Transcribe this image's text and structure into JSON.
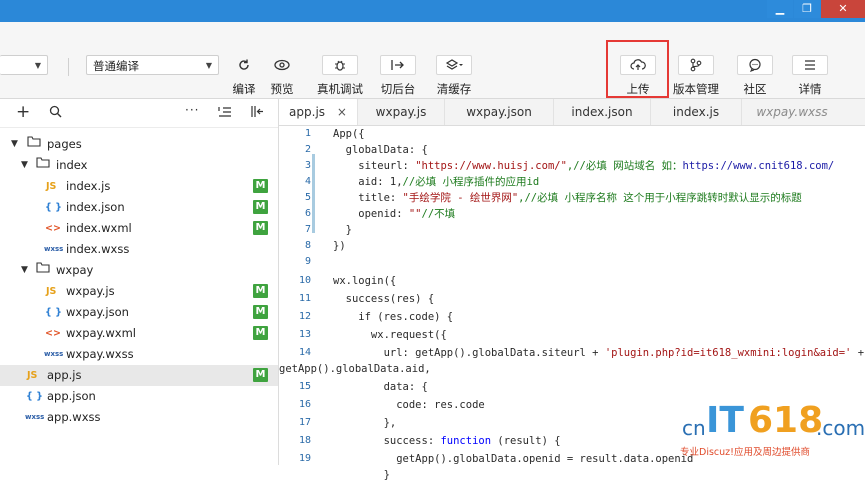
{
  "toolbar": {
    "mode_select": "普通编译",
    "buttons": {
      "compile": "编译",
      "preview": "预览",
      "remote_debug": "真机调试",
      "background": "切后台",
      "clear_cache": "清缓存",
      "upload": "上传",
      "version": "版本管理",
      "community": "社区",
      "details": "详情"
    }
  },
  "tree": {
    "pages": "pages",
    "index": "index",
    "index_js": "index.js",
    "index_json": "index.json",
    "index_wxml": "index.wxml",
    "index_wxss": "index.wxss",
    "wxpay": "wxpay",
    "wxpay_js": "wxpay.js",
    "wxpay_json": "wxpay.json",
    "wxpay_wxml": "wxpay.wxml",
    "wxpay_wxss": "wxpay.wxss",
    "app_js": "app.js",
    "app_json": "app.json",
    "app_wxss": "app.wxss",
    "modified_badge": "M",
    "icons": {
      "js": "JS",
      "json": "{ }",
      "wxml": "<>",
      "wxss": "wxss"
    }
  },
  "tabs": [
    "app.js",
    "wxpay.js",
    "wxpay.json",
    "index.json",
    "index.js",
    "wxpay.wxss"
  ],
  "tab_close": "×",
  "code": {
    "l1": "App({",
    "l2": "  globalData: {",
    "l3_key": "    siteurl: ",
    "l3_str": "\"https://www.huisj.com/\"",
    "l3_comment": ",//必填 网站域名 如：",
    "l3_link": "https://www.cnit618.com/",
    "l4_code": "    aid: 1,",
    "l4_comment": "//必填 小程序插件的应用id",
    "l5_key": "    title: ",
    "l5_str": "\"手绘学院 - 绘世界网\"",
    "l5_comment": ",//必填 小程序名称 这个用于小程序跳转时默认显示的标题",
    "l6_key": "    openid: ",
    "l6_str": "\"\"",
    "l6_comment": "//不填",
    "l7": "  }",
    "l8": "})",
    "l9": "",
    "l10": "wx.login({",
    "l11": "  success(res) {",
    "l12": "    if (res.code) {",
    "l13": "      wx.request({",
    "l14_code": "        url: getApp().globalData.siteurl + ",
    "l14_str": "'plugin.php?id=it618_wxmini:login&aid='",
    "l14_tail": " +",
    "l14_cont": "getApp().globalData.aid,",
    "l15": "        data: {",
    "l16": "          code: res.code",
    "l17": "        },",
    "l18_a": "        success: ",
    "l18_kw": "function",
    "l18_b": " (result) {",
    "l19": "          getApp().globalData.openid = result.data.openid",
    "l20": "        }"
  },
  "watermark": {
    "cn": "cn",
    "it": "IT",
    "num": "618",
    "com": ".com",
    "tagline": "专业Discuz!应用及周边提供商"
  },
  "colors": {
    "accent_blue": "#2b88d8",
    "modified_green": "#3fa33f",
    "highlight_red": "#e53935"
  }
}
